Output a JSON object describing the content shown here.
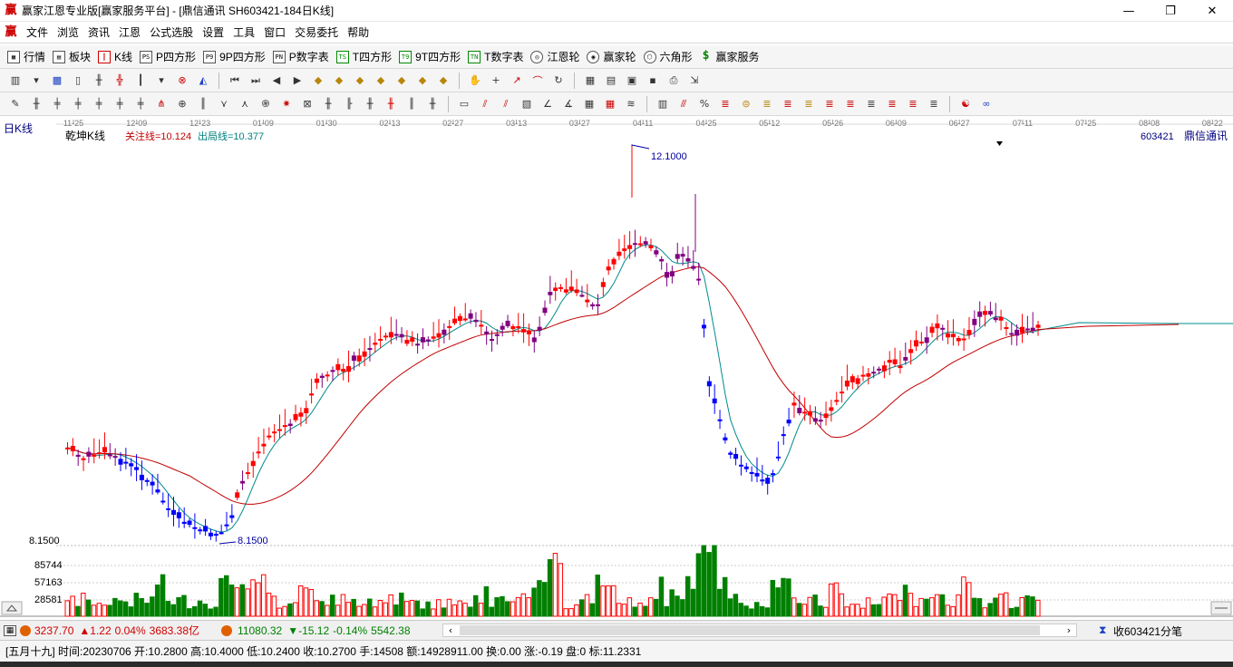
{
  "window": {
    "title": "赢家江恩专业版[赢家服务平台] - [鼎信通讯  SH603421-184日K线]",
    "logo": "赢",
    "controls": [
      "—",
      "❐",
      "✕"
    ]
  },
  "menu": {
    "logo": "赢",
    "items": [
      "文件",
      "浏览",
      "资讯",
      "江恩",
      "公式选股",
      "设置",
      "工具",
      "窗口",
      "交易委托",
      "帮助"
    ],
    "mdi_controls": [
      "_",
      "❐",
      "✕"
    ]
  },
  "funcbar": {
    "items": [
      {
        "icon": "table-icon",
        "label": "行情"
      },
      {
        "icon": "blocks-icon",
        "label": "板块"
      },
      {
        "icon": "kline-icon",
        "label": "K线"
      },
      {
        "icon": "PS",
        "label": "P四方形"
      },
      {
        "icon": "P9",
        "label": "9P四方形"
      },
      {
        "icon": "PN",
        "label": "P数字表"
      },
      {
        "icon": "TS",
        "label": "T四方形"
      },
      {
        "icon": "T9",
        "label": "9T四方形"
      },
      {
        "icon": "TN",
        "label": "T数字表"
      },
      {
        "icon": "wheel-icon",
        "label": "江恩轮"
      },
      {
        "icon": "wheel-icon",
        "label": "赢家轮"
      },
      {
        "icon": "hexagon-icon",
        "label": "六角形"
      },
      {
        "icon": "dollar-icon",
        "label": "赢家服务"
      }
    ]
  },
  "chart": {
    "period_label": "日K线",
    "indicator_name": "乾坤K线",
    "focus_line": "关注线=10.124",
    "exit_line": "出局线=10.377",
    "stock_code": "603421",
    "stock_name": "鼎信通讯",
    "high_label": "12.1000",
    "low_label": "8.1500",
    "date_ticks": [
      "11-25",
      "12-09",
      "12-23",
      "01-09",
      "01-30",
      "02-13",
      "02-27",
      "03-13",
      "03-27",
      "04-11",
      "04-25",
      "05-12",
      "05-26",
      "06-09",
      "06-27",
      "07-11",
      "07-25",
      "08-08",
      "08-22"
    ],
    "y_labels": [
      "8.1500",
      "85744",
      "57163",
      "28581"
    ],
    "colors": {
      "up": "#ff0000",
      "down": "#0000ff",
      "purple": "#800080",
      "vol_down": "#008000",
      "ma_slow": "#c00000",
      "ma_fast": "#008b8b"
    }
  },
  "status1": {
    "index1_value": "3237.70",
    "index1_change": "▲1.22",
    "index1_pct": "0.04%",
    "index1_amount": "3683.38亿",
    "index2_value": "11080.32",
    "index2_change": "▼-15.12",
    "index2_pct": "-0.14%",
    "index2_amount": "5542.38",
    "right_text": "收603421分笔"
  },
  "status2": {
    "text": "[五月十九] 时间:20230706 开:10.2800 高:10.4000 低:10.2400 收:10.2700 手:14508 额:14928911.00 换:0.00 涨:-0.19 盘:0 标:11.2331"
  }
}
